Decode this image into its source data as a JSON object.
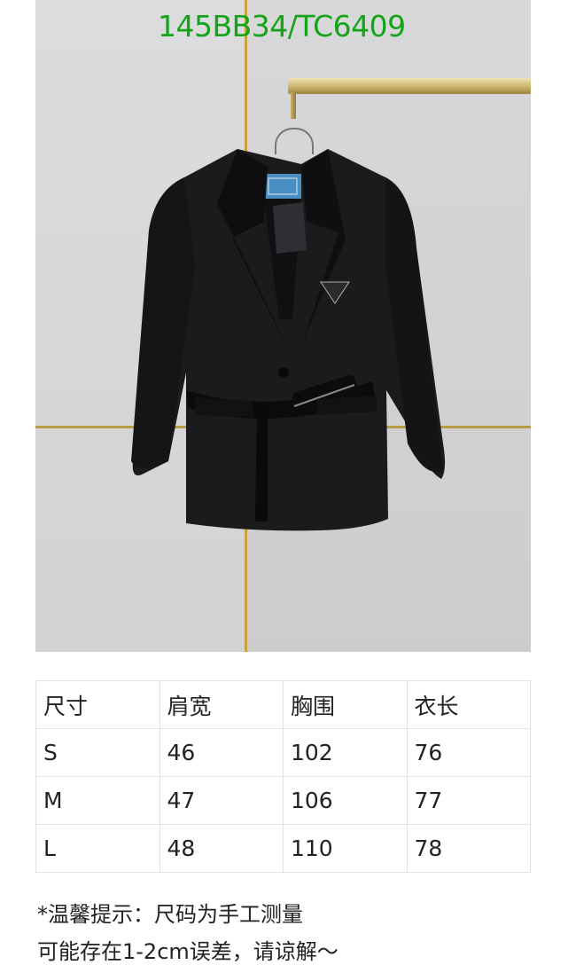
{
  "watermark": "145BB34/TC6409",
  "photo": {
    "subject": "black belted blazer on hanger",
    "accent_colors": {
      "wall": "#d6d6d8",
      "trim": "#c9a33c",
      "garment": "#18181a",
      "label": "#4a8fc4"
    }
  },
  "size_table": {
    "headers": [
      "尺寸",
      "肩宽",
      "胸围",
      "衣长"
    ],
    "rows": [
      [
        "S",
        "46",
        "102",
        "76"
      ],
      [
        "M",
        "47",
        "106",
        "77"
      ],
      [
        "L",
        "48",
        "110",
        "78"
      ]
    ]
  },
  "note": {
    "line1": "*温馨提示：尺码为手工测量",
    "line2": "可能存在1-2cm误差，请谅解～"
  }
}
